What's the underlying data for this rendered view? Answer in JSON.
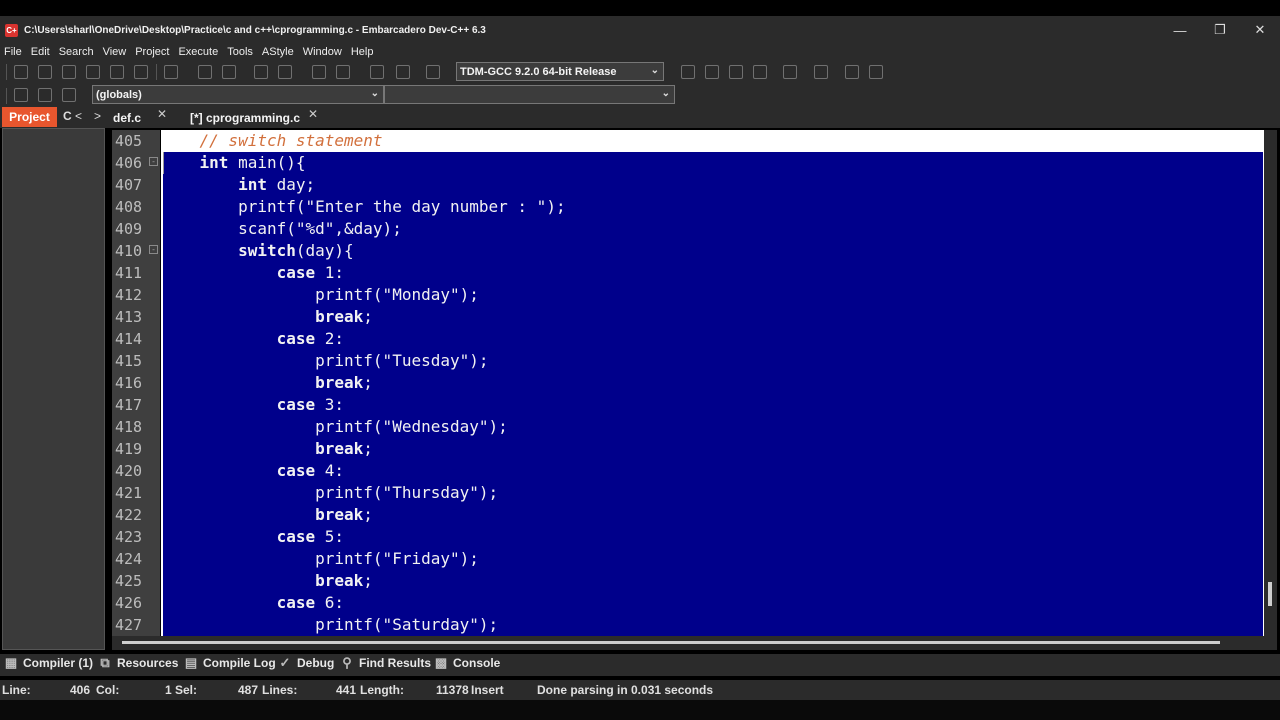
{
  "window": {
    "title": "C:\\Users\\sharl\\OneDrive\\Desktop\\Practice\\c and c++\\cprogramming.c - Embarcadero Dev-C++ 6.3",
    "icon_text": "C+"
  },
  "menu": [
    "File",
    "Edit",
    "Search",
    "View",
    "Project",
    "Execute",
    "Tools",
    "AStyle",
    "Window",
    "Help"
  ],
  "toolbar": {
    "compiler_select": "TDM-GCC 9.2.0 64-bit Release",
    "scope_select": "(globals)",
    "member_select": ""
  },
  "tabs": {
    "project_tab": "Project",
    "classes_tab_partial": "C",
    "nav_prev": "<",
    "nav_next": ">",
    "files": [
      {
        "label": "def.c",
        "active": false
      },
      {
        "label": "[*] cprogramming.c",
        "active": true
      }
    ]
  },
  "editor": {
    "line_numbers": [
      "405",
      "406",
      "407",
      "408",
      "409",
      "410",
      "411",
      "412",
      "413",
      "414",
      "415",
      "416",
      "417",
      "418",
      "419",
      "420",
      "421",
      "422",
      "423",
      "424",
      "425",
      "426",
      "427"
    ],
    "fold_markers": {
      "406": "⊟",
      "410": "⊟"
    },
    "lines": [
      {
        "indent": "    ",
        "text": "// switch statement",
        "cls": "comment"
      },
      {
        "indent": "    ",
        "kw": "int",
        "text": " main(){"
      },
      {
        "indent": "        ",
        "kw": "int",
        "text": " day;"
      },
      {
        "indent": "        ",
        "text": "printf(\"Enter the day number : \");"
      },
      {
        "indent": "        ",
        "text": "scanf(\"%d\",&day);"
      },
      {
        "indent": "        ",
        "kw": "switch",
        "text": "(day){"
      },
      {
        "indent": "            ",
        "kw": "case",
        "text": " 1:"
      },
      {
        "indent": "                ",
        "text": "printf(\"Monday\");"
      },
      {
        "indent": "                ",
        "kw": "break",
        "text": ";"
      },
      {
        "indent": "            ",
        "kw": "case",
        "text": " 2:"
      },
      {
        "indent": "                ",
        "text": "printf(\"Tuesday\");"
      },
      {
        "indent": "                ",
        "kw": "break",
        "text": ";"
      },
      {
        "indent": "            ",
        "kw": "case",
        "text": " 3:"
      },
      {
        "indent": "                ",
        "text": "printf(\"Wednesday\");"
      },
      {
        "indent": "                ",
        "kw": "break",
        "text": ";"
      },
      {
        "indent": "            ",
        "kw": "case",
        "text": " 4:"
      },
      {
        "indent": "                ",
        "text": "printf(\"Thursday\");"
      },
      {
        "indent": "                ",
        "kw": "break",
        "text": ";"
      },
      {
        "indent": "            ",
        "kw": "case",
        "text": " 5:"
      },
      {
        "indent": "                ",
        "text": "printf(\"Friday\");"
      },
      {
        "indent": "                ",
        "kw": "break",
        "text": ";"
      },
      {
        "indent": "            ",
        "kw": "case",
        "text": " 6:"
      },
      {
        "indent": "                ",
        "text": "printf(\"Saturday\");"
      }
    ]
  },
  "bottom_tabs": [
    {
      "label": "Compiler (1)",
      "icon": "grid-icon"
    },
    {
      "label": "Resources",
      "icon": "resources-icon"
    },
    {
      "label": "Compile Log",
      "icon": "bar-chart-icon"
    },
    {
      "label": "Debug",
      "icon": "check-icon"
    },
    {
      "label": "Find Results",
      "icon": "find-icon"
    },
    {
      "label": "Console",
      "icon": "console-icon"
    }
  ],
  "status": {
    "line_label": "Line:",
    "line_value": "406",
    "col_label": "Col:",
    "col_value": "1",
    "sel_label": "Sel:",
    "lines_value": "487",
    "lines_label": "Lines:",
    "length_value": "441",
    "length_label": "Length:",
    "chars_value": "11378",
    "mode": "Insert",
    "message": "Done parsing in 0.031 seconds"
  },
  "colors": {
    "selection": "#00008b",
    "comment": "#d2703c",
    "project_tab": "#e8562e",
    "chrome": "#2b2b2b"
  }
}
